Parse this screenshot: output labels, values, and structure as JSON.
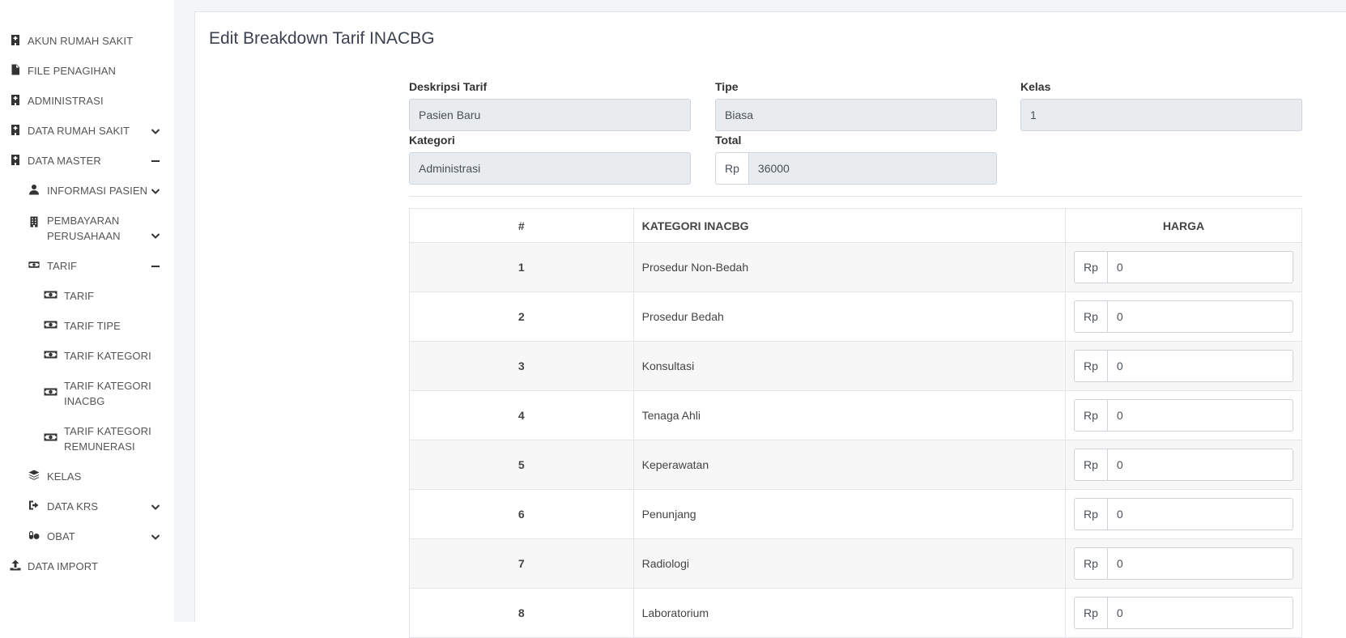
{
  "sidebar": {
    "items": [
      {
        "label": "AKUN RUMAH SAKIT",
        "icon": "hospital-icon"
      },
      {
        "label": "FILE PENAGIHAN",
        "icon": "file-icon"
      },
      {
        "label": "ADMINISTRASI",
        "icon": "hospital-icon"
      },
      {
        "label": "DATA RUMAH SAKIT",
        "icon": "hospital-icon",
        "chevron": "chevron-down-icon"
      },
      {
        "label": "DATA MASTER",
        "icon": "hospital-icon",
        "chevron": "minus-icon"
      },
      {
        "label": "INFORMASI PASIEN",
        "icon": "user-icon",
        "chevron": "chevron-down-icon"
      },
      {
        "label": "PEMBAYARAN PERUSAHAAN",
        "icon": "building-icon",
        "chevron": "chevron-down-icon"
      },
      {
        "label": "TARIF",
        "icon": "money-icon",
        "chevron": "minus-icon"
      },
      {
        "label": "TARIF",
        "icon": "money-icon"
      },
      {
        "label": "TARIF TIPE",
        "icon": "money-icon"
      },
      {
        "label": "TARIF KATEGORI",
        "icon": "money-icon"
      },
      {
        "label": "TARIF KATEGORI INACBG",
        "icon": "money-icon"
      },
      {
        "label": "TARIF KATEGORI REMUNERASI",
        "icon": "money-icon"
      },
      {
        "label": "KELAS",
        "icon": "layers-icon"
      },
      {
        "label": "DATA KRS",
        "icon": "sign-out-icon",
        "chevron": "chevron-down-icon"
      },
      {
        "label": "OBAT",
        "icon": "pills-icon",
        "chevron": "chevron-down-icon"
      },
      {
        "label": "DATA IMPORT",
        "icon": "upload-icon"
      }
    ]
  },
  "page": {
    "title": "Edit Breakdown Tarif INACBG"
  },
  "form": {
    "deskripsi_label": "Deskripsi Tarif",
    "deskripsi_value": "Pasien Baru",
    "tipe_label": "Tipe",
    "tipe_value": "Biasa",
    "kelas_label": "Kelas",
    "kelas_value": "1",
    "kategori_label": "Kategori",
    "kategori_value": "Administrasi",
    "total_label": "Total",
    "total_prefix": "Rp",
    "total_value": "36000"
  },
  "table": {
    "headers": [
      "#",
      "KATEGORI INACBG",
      "HARGA"
    ],
    "currency": "Rp",
    "rows": [
      {
        "num": "1",
        "kategori": "Prosedur Non-Bedah",
        "harga": "0"
      },
      {
        "num": "2",
        "kategori": "Prosedur Bedah",
        "harga": "0"
      },
      {
        "num": "3",
        "kategori": "Konsultasi",
        "harga": "0"
      },
      {
        "num": "4",
        "kategori": "Tenaga Ahli",
        "harga": "0"
      },
      {
        "num": "5",
        "kategori": "Keperawatan",
        "harga": "0"
      },
      {
        "num": "6",
        "kategori": "Penunjang",
        "harga": "0"
      },
      {
        "num": "7",
        "kategori": "Radiologi",
        "harga": "0"
      },
      {
        "num": "8",
        "kategori": "Laboratorium",
        "harga": "0"
      }
    ]
  }
}
